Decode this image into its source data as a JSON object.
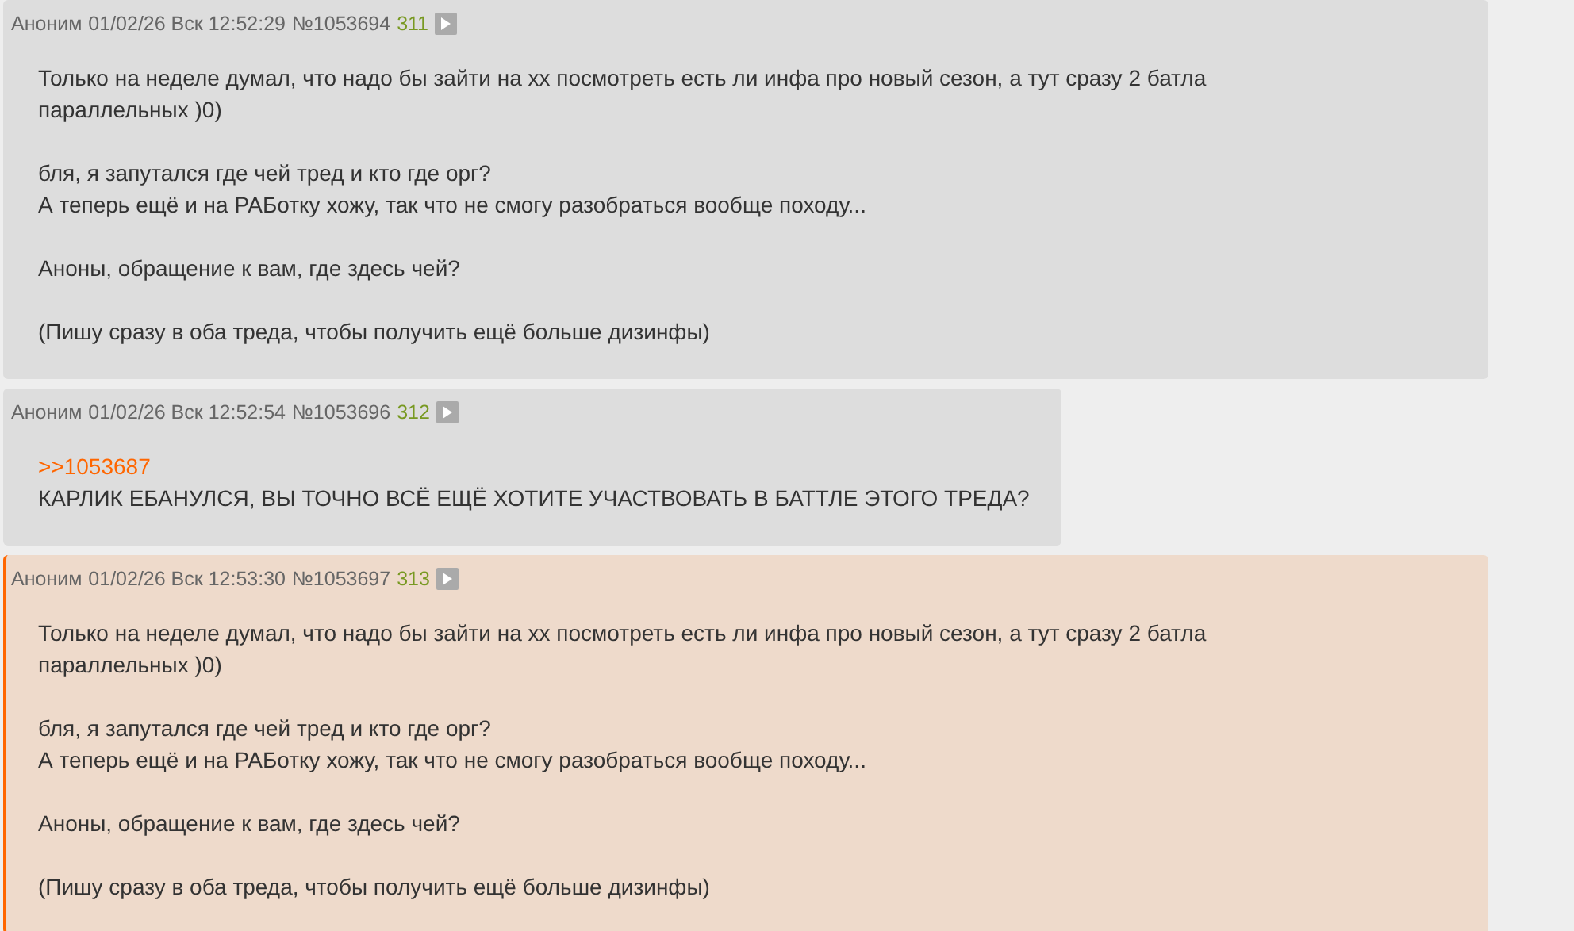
{
  "posts": [
    {
      "author": "Аноним",
      "date": "01/02/26 Вск 12:52:29",
      "number": "№1053694",
      "ordinal": "311",
      "highlighted": false,
      "wide": true,
      "body": [
        {
          "kind": "text",
          "lines": [
            "Только на неделе думал, что надо бы зайти на хх посмотреть есть ли инфа про новый сезон, а тут сразу 2 батла параллельных )0)"
          ]
        },
        {
          "kind": "text",
          "lines": [
            "бля, я запутался где чей тред и кто где орг?",
            "А теперь ещё и на РАБотку хожу, так что не смогу разобраться вообще походу..."
          ]
        },
        {
          "kind": "text",
          "lines": [
            "Аноны, обращение к вам, где здесь чей?"
          ]
        },
        {
          "kind": "text",
          "lines": [
            "(Пишу сразу в оба треда, чтобы получить ещё больше дизинфы)"
          ]
        }
      ]
    },
    {
      "author": "Аноним",
      "date": "01/02/26 Вск 12:52:54",
      "number": "№1053696",
      "ordinal": "312",
      "highlighted": false,
      "wide": false,
      "body": [
        {
          "kind": "reply",
          "lines": [
            ">>1053687",
            "КАРЛИК ЕБАНУЛСЯ, ВЫ ТОЧНО ВСЁ ЕЩЁ ХОТИТЕ УЧАСТВОВАТЬ В БАТТЛЕ ЭТОГО ТРЕДА?"
          ]
        }
      ]
    },
    {
      "author": "Аноним",
      "date": "01/02/26 Вск 12:53:30",
      "number": "№1053697",
      "ordinal": "313",
      "highlighted": true,
      "wide": true,
      "body": [
        {
          "kind": "text",
          "lines": [
            "Только на неделе думал, что надо бы зайти на хх посмотреть есть ли инфа про новый сезон, а тут сразу 2 батла параллельных )0)"
          ]
        },
        {
          "kind": "text",
          "lines": [
            "бля, я запутался где чей тред и кто где орг?",
            "А теперь ещё и на РАБотку хожу, так что не смогу разобраться вообще походу..."
          ]
        },
        {
          "kind": "text",
          "lines": [
            "Аноны, обращение к вам, где здесь чей?"
          ]
        },
        {
          "kind": "text",
          "lines": [
            "(Пишу сразу в оба треда, чтобы получить ещё больше дизинфы)"
          ]
        }
      ]
    }
  ]
}
